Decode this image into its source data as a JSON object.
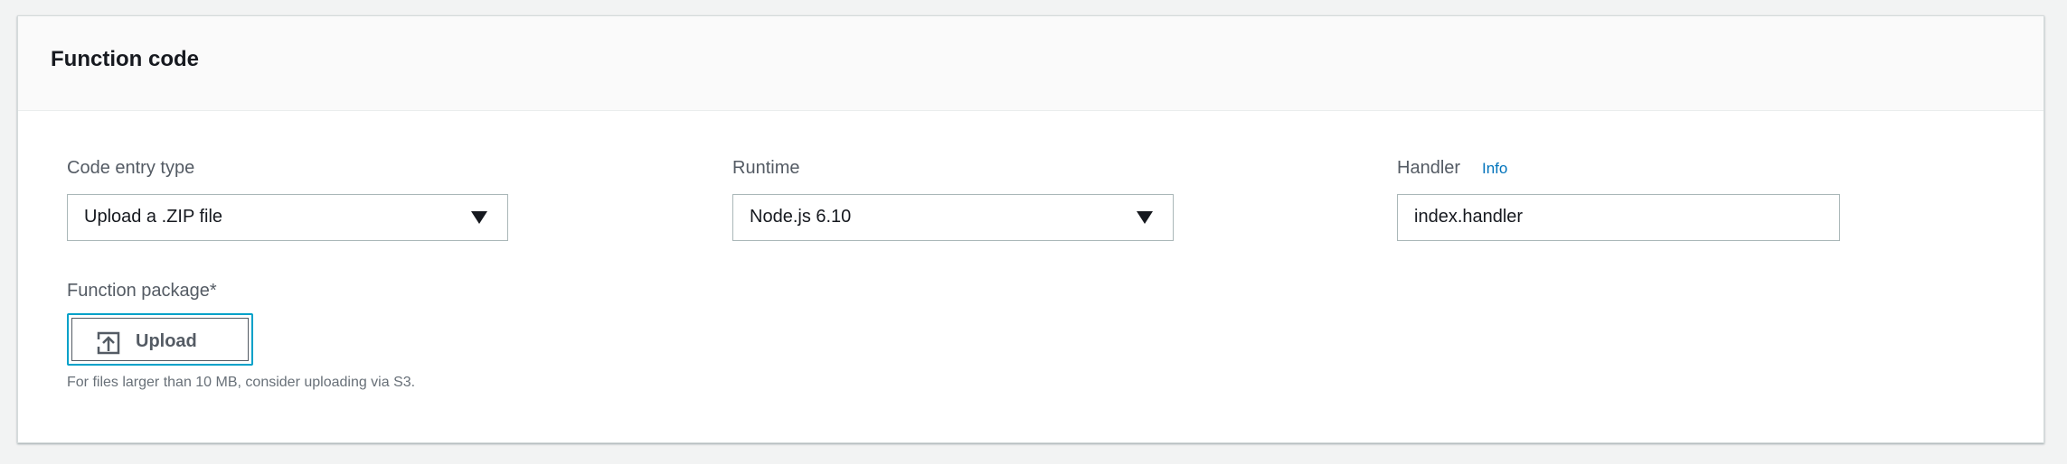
{
  "panel": {
    "title": "Function code"
  },
  "code_entry": {
    "label": "Code entry type",
    "selected": "Upload a .ZIP file"
  },
  "runtime": {
    "label": "Runtime",
    "selected": "Node.js 6.10"
  },
  "handler": {
    "label": "Handler",
    "info_link": "Info",
    "value": "index.handler"
  },
  "function_package": {
    "label": "Function package*",
    "upload_label": "Upload",
    "hint": "For files larger than 10 MB, consider uploading via S3."
  },
  "icons": {
    "caret": "caret-down-icon",
    "upload": "upload-icon"
  },
  "colors": {
    "link": "#0073bb",
    "focus_border": "#00a1c9"
  }
}
